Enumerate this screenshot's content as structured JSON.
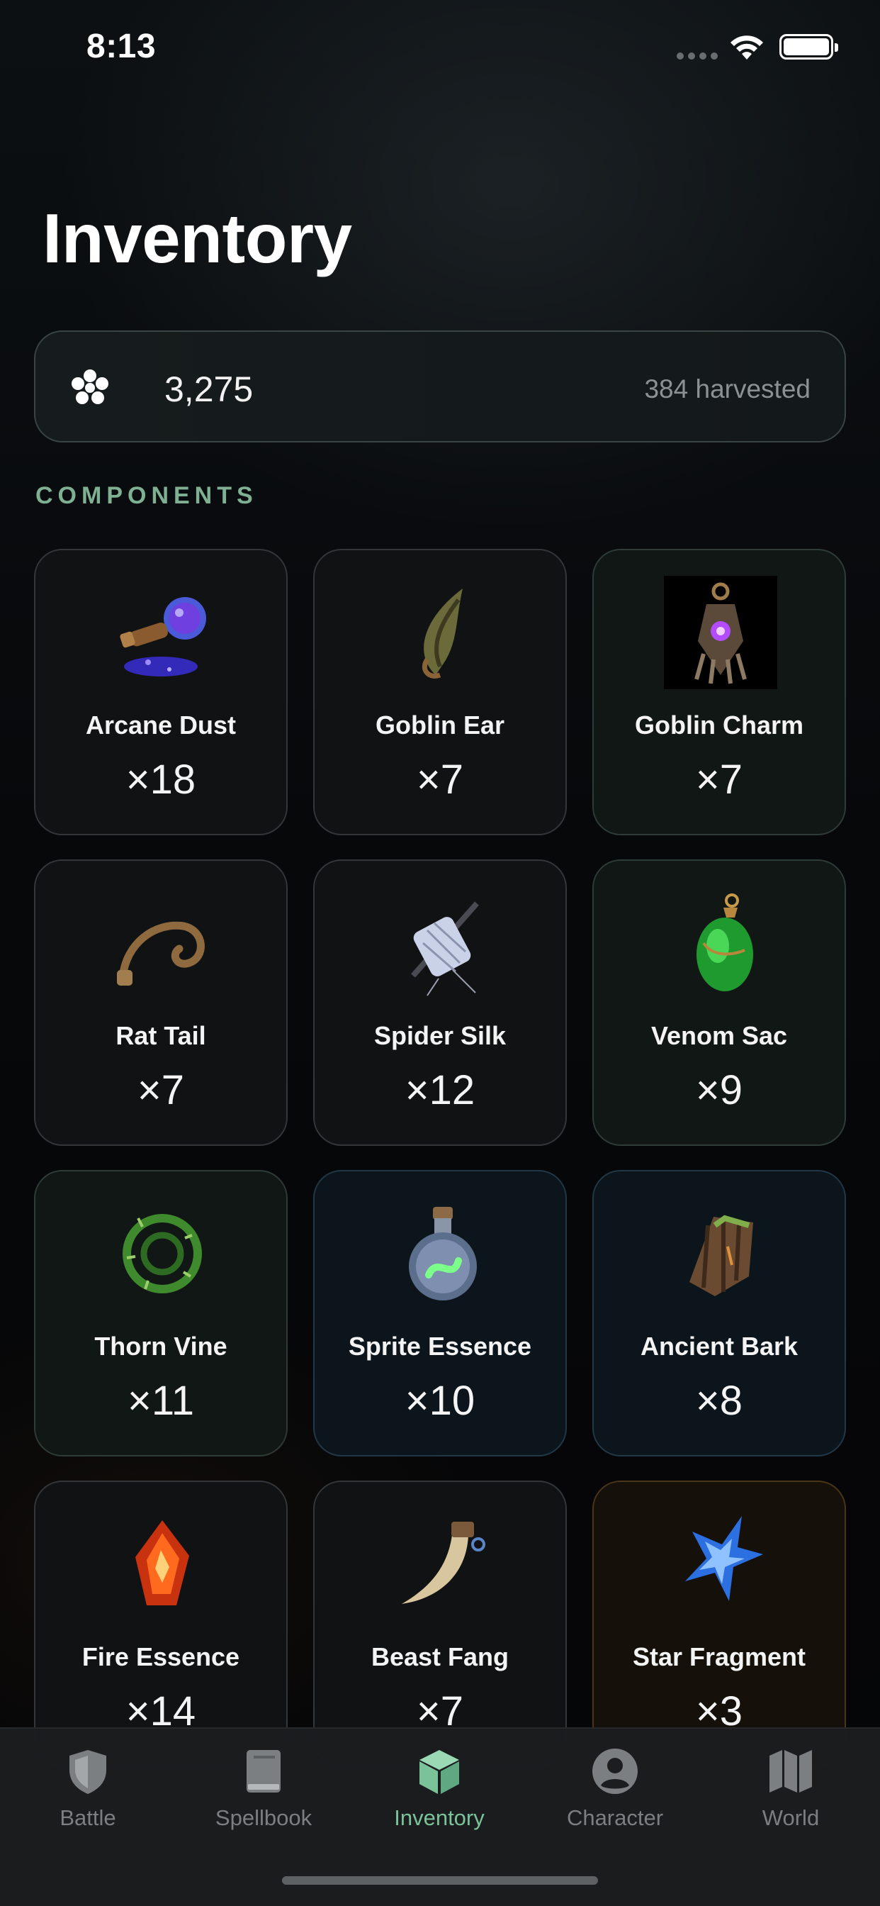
{
  "status_bar": {
    "time": "8:13"
  },
  "header": {
    "title": "Inventory"
  },
  "currency": {
    "amount": "3,275",
    "harvested": "384 harvested",
    "icon": "flower-currency-icon"
  },
  "section": {
    "label": "COMPONENTS"
  },
  "components": [
    {
      "name": "Arcane Dust",
      "qty": "×18",
      "icon": "arcane-dust-icon"
    },
    {
      "name": "Goblin Ear",
      "qty": "×7",
      "icon": "goblin-ear-icon"
    },
    {
      "name": "Goblin Charm",
      "qty": "×7",
      "icon": "goblin-charm-icon"
    },
    {
      "name": "Rat Tail",
      "qty": "×7",
      "icon": "rat-tail-icon"
    },
    {
      "name": "Spider Silk",
      "qty": "×12",
      "icon": "spider-silk-icon"
    },
    {
      "name": "Venom Sac",
      "qty": "×9",
      "icon": "venom-sac-icon"
    },
    {
      "name": "Thorn Vine",
      "qty": "×11",
      "icon": "thorn-vine-icon"
    },
    {
      "name": "Sprite Essence",
      "qty": "×10",
      "icon": "sprite-essence-icon"
    },
    {
      "name": "Ancient Bark",
      "qty": "×8",
      "icon": "ancient-bark-icon"
    },
    {
      "name": "Fire Essence",
      "qty": "×14",
      "icon": "fire-essence-icon"
    },
    {
      "name": "Beast Fang",
      "qty": "×7",
      "icon": "beast-fang-icon"
    },
    {
      "name": "Star Fragment",
      "qty": "×3",
      "icon": "star-fragment-icon"
    }
  ],
  "tab_bar": {
    "tabs": [
      {
        "label": "Battle",
        "icon": "shield-icon"
      },
      {
        "label": "Spellbook",
        "icon": "book-icon"
      },
      {
        "label": "Inventory",
        "icon": "box-icon",
        "active": true
      },
      {
        "label": "Character",
        "icon": "person-icon"
      },
      {
        "label": "World",
        "icon": "map-icon"
      }
    ]
  },
  "colors": {
    "accent": "#79c29a",
    "section_label": "#7fb093",
    "inactive_tab": "#7b7f82"
  }
}
